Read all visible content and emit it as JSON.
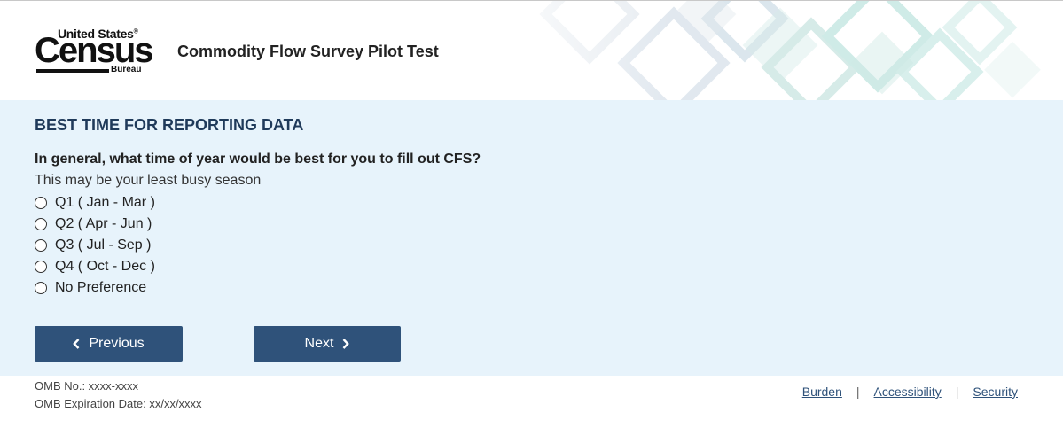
{
  "header": {
    "logo": {
      "line1": "United States",
      "registered": "®",
      "line2": "Census",
      "line3": "Bureau"
    },
    "app_title": "Commodity Flow Survey Pilot Test"
  },
  "main": {
    "section_title": "BEST TIME FOR REPORTING DATA",
    "question": "In general, what time of year would be best for you to fill out CFS?",
    "hint": "This may be your least busy season",
    "options": [
      {
        "label": "Q1 ( Jan - Mar )",
        "selected": false
      },
      {
        "label": "Q2 ( Apr - Jun )",
        "selected": false
      },
      {
        "label": "Q3 ( Jul - Sep )",
        "selected": false
      },
      {
        "label": "Q4 ( Oct - Dec )",
        "selected": false
      },
      {
        "label": "No Preference",
        "selected": false
      }
    ],
    "buttons": {
      "previous": "Previous",
      "next": "Next"
    }
  },
  "footer": {
    "omb_no": "OMB No.: xxxx-xxxx",
    "omb_expiration": "OMB Expiration Date: xx/xx/xxxx",
    "links": [
      "Burden",
      "Accessibility",
      "Security"
    ],
    "separator": "|"
  },
  "colors": {
    "content_bg": "#e7f3fb",
    "primary_button": "#2f527a",
    "section_title": "#1f3a5a",
    "link": "#2f527a"
  },
  "icons": {
    "previous": "chevron-left-icon",
    "next": "chevron-right-icon"
  }
}
